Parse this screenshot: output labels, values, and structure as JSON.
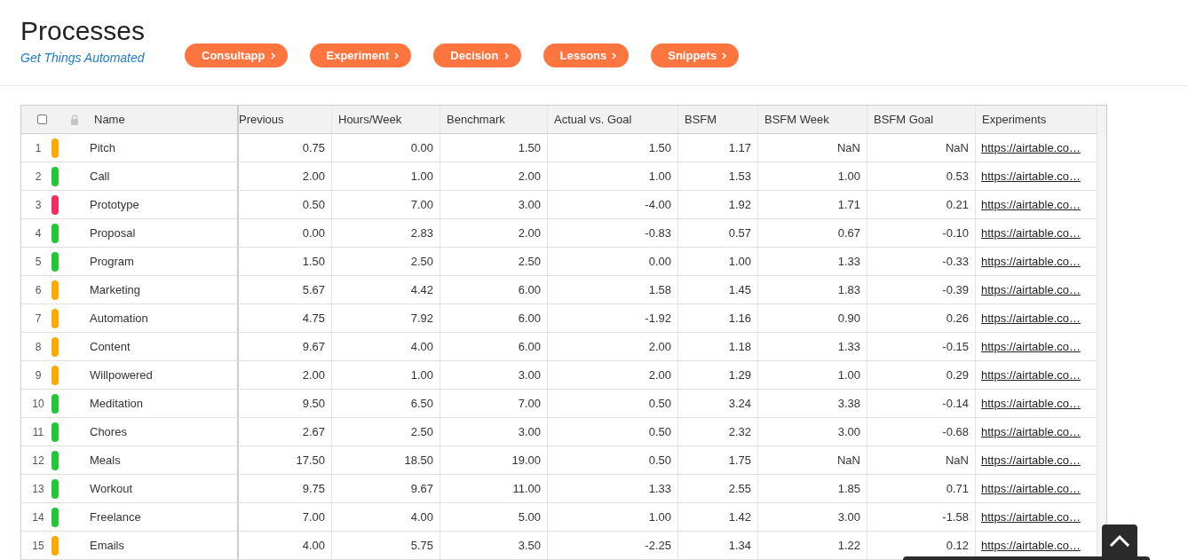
{
  "header": {
    "title": "Processes",
    "subtitle": "Get Things Automated",
    "buttons": [
      {
        "label": "Consultapp"
      },
      {
        "label": "Experiment"
      },
      {
        "label": "Decision"
      },
      {
        "label": "Lessons"
      },
      {
        "label": "Snippets"
      }
    ]
  },
  "table": {
    "select_all": {
      "checked": false
    },
    "columns": [
      "Name",
      "Previous",
      "Hours/Week",
      "Benchmark",
      "Actual vs. Goal",
      "BSFM",
      "BSFM Week",
      "BSFM Goal",
      "Experiments"
    ],
    "rows": [
      {
        "number": "1",
        "color": "#ffa800",
        "name": "Pitch",
        "cells": [
          "0.75",
          "0.00",
          "1.50",
          "1.50",
          "1.17",
          "NaN",
          "NaN"
        ],
        "link": "https://airtable.co…"
      },
      {
        "number": "2",
        "color": "#20c933",
        "name": "Call",
        "cells": [
          "2.00",
          "1.00",
          "2.00",
          "1.00",
          "1.53",
          "1.00",
          "0.53"
        ],
        "link": "https://airtable.co…"
      },
      {
        "number": "3",
        "color": "#f82b60",
        "name": "Prototype",
        "cells": [
          "0.50",
          "7.00",
          "3.00",
          "-4.00",
          "1.92",
          "1.71",
          "0.21"
        ],
        "link": "https://airtable.co…"
      },
      {
        "number": "4",
        "color": "#20c933",
        "name": "Proposal",
        "cells": [
          "0.00",
          "2.83",
          "2.00",
          "-0.83",
          "0.57",
          "0.67",
          "-0.10"
        ],
        "link": "https://airtable.co…"
      },
      {
        "number": "5",
        "color": "#20c933",
        "name": "Program",
        "cells": [
          "1.50",
          "2.50",
          "2.50",
          "0.00",
          "1.00",
          "1.33",
          "-0.33"
        ],
        "link": "https://airtable.co…"
      },
      {
        "number": "6",
        "color": "#ffa800",
        "name": "Marketing",
        "cells": [
          "5.67",
          "4.42",
          "6.00",
          "1.58",
          "1.45",
          "1.83",
          "-0.39"
        ],
        "link": "https://airtable.co…"
      },
      {
        "number": "7",
        "color": "#ffa800",
        "name": "Automation",
        "cells": [
          "4.75",
          "7.92",
          "6.00",
          "-1.92",
          "1.16",
          "0.90",
          "0.26"
        ],
        "link": "https://airtable.co…"
      },
      {
        "number": "8",
        "color": "#ffa800",
        "name": "Content",
        "cells": [
          "9.67",
          "4.00",
          "6.00",
          "2.00",
          "1.18",
          "1.33",
          "-0.15"
        ],
        "link": "https://airtable.co…"
      },
      {
        "number": "9",
        "color": "#ffa800",
        "name": "Willpowered",
        "cells": [
          "2.00",
          "1.00",
          "3.00",
          "2.00",
          "1.29",
          "1.00",
          "0.29"
        ],
        "link": "https://airtable.co…"
      },
      {
        "number": "10",
        "color": "#20c933",
        "name": "Meditation",
        "cells": [
          "9.50",
          "6.50",
          "7.00",
          "0.50",
          "3.24",
          "3.38",
          "-0.14"
        ],
        "link": "https://airtable.co…"
      },
      {
        "number": "11",
        "color": "#20c933",
        "name": "Chores",
        "cells": [
          "2.67",
          "2.50",
          "3.00",
          "0.50",
          "2.32",
          "3.00",
          "-0.68"
        ],
        "link": "https://airtable.co…"
      },
      {
        "number": "12",
        "color": "#20c933",
        "name": "Meals",
        "cells": [
          "17.50",
          "18.50",
          "19.00",
          "0.50",
          "1.75",
          "NaN",
          "NaN"
        ],
        "link": "https://airtable.co…"
      },
      {
        "number": "13",
        "color": "#20c933",
        "name": "Workout",
        "cells": [
          "9.75",
          "9.67",
          "11.00",
          "1.33",
          "2.55",
          "1.85",
          "0.71"
        ],
        "link": "https://airtable.co…"
      },
      {
        "number": "14",
        "color": "#20c933",
        "name": "Freelance",
        "cells": [
          "7.00",
          "4.00",
          "5.00",
          "1.00",
          "1.42",
          "3.00",
          "-1.58"
        ],
        "link": "https://airtable.co…"
      },
      {
        "number": "15",
        "color": "#ffa800",
        "name": "Emails",
        "cells": [
          "4.00",
          "5.75",
          "3.50",
          "-2.25",
          "1.34",
          "1.22",
          "0.12"
        ],
        "link": "https://airtable.co…"
      }
    ]
  }
}
